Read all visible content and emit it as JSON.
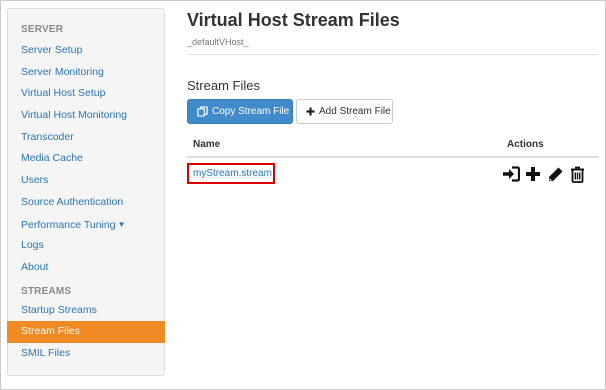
{
  "sidebar": {
    "server_header": "SERVER",
    "server_items": [
      {
        "label": "Server Setup"
      },
      {
        "label": "Server Monitoring"
      },
      {
        "label": "Virtual Host Setup"
      },
      {
        "label": "Virtual Host Monitoring"
      },
      {
        "label": "Transcoder"
      },
      {
        "label": "Media Cache"
      },
      {
        "label": "Users"
      },
      {
        "label": "Source Authentication"
      },
      {
        "label": "Performance Tuning",
        "has_dropdown": true,
        "icon": "caret-down-icon"
      },
      {
        "label": "Logs"
      },
      {
        "label": "About"
      }
    ],
    "streams_header": "STREAMS",
    "streams_items": [
      {
        "label": "Startup Streams"
      },
      {
        "label": "Stream Files",
        "active": true
      },
      {
        "label": "SMIL Files"
      }
    ]
  },
  "main": {
    "title": "Virtual Host Stream Files",
    "subtitle": "_defaultVHost_",
    "section_title": "Stream Files",
    "buttons": {
      "copy_label": "Copy Stream File",
      "copy_icon": "copy-icon",
      "add_label": "Add Stream File",
      "add_icon": "plus-icon"
    },
    "table": {
      "columns": [
        "Name",
        "Actions"
      ],
      "rows": [
        {
          "name": "myStream.stream",
          "highlighted": true,
          "actions": [
            "connect-icon",
            "add-icon",
            "edit-icon",
            "delete-icon"
          ]
        }
      ]
    }
  },
  "colors": {
    "accent_active": "#f08a24",
    "link": "#2a75b8",
    "primary_button": "#428bca",
    "highlight_border": "#dd0000"
  }
}
